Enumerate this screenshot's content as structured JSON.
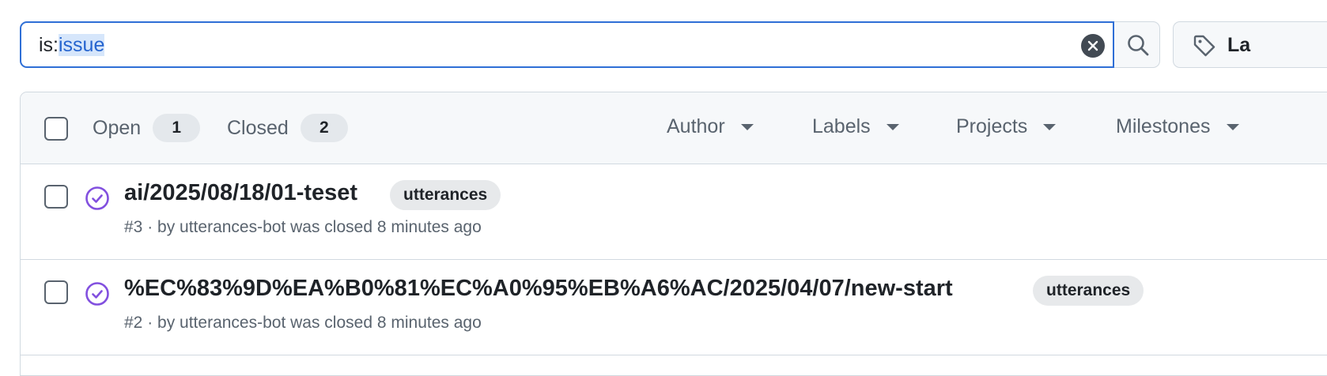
{
  "search": {
    "query_prefix": "is:",
    "query_selected": "issue",
    "search_button_icon": "search-icon",
    "clear_icon": "x-circle-fill-icon"
  },
  "labels_button": {
    "label": "La",
    "icon": "tag-icon"
  },
  "header": {
    "open": {
      "label": "Open",
      "count": "1"
    },
    "closed": {
      "label": "Closed",
      "count": "2"
    },
    "filters": [
      "Author",
      "Labels",
      "Projects",
      "Milestones"
    ]
  },
  "issues": [
    {
      "title": "ai/2025/08/18/01-teset",
      "label": "utterances",
      "number": "#3",
      "meta_text": "by utterances-bot was closed 8 minutes ago",
      "state_icon": "issue-closed-icon"
    },
    {
      "title": "%EC%83%9D%EA%B0%81%EC%A0%95%EB%A6%AC/2025/04/07/new-start",
      "label": "utterances",
      "number": "#2",
      "meta_text": "by utterances-bot was closed 8 minutes ago",
      "state_icon": "issue-closed-icon"
    }
  ],
  "colors": {
    "focus_border": "#2f6fd6",
    "closed_state": "#8250df",
    "muted_text": "#59636e",
    "border": "#d1d9e0"
  }
}
